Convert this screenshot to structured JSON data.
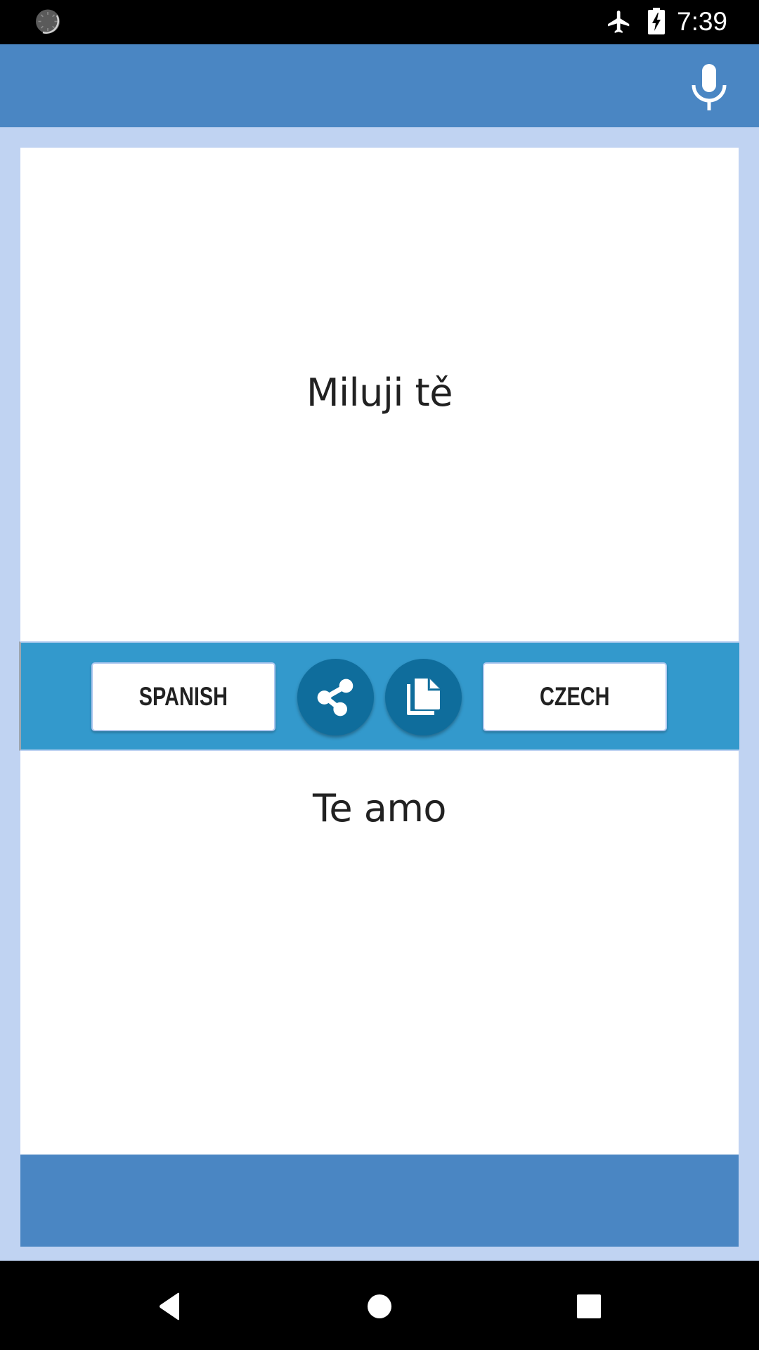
{
  "status_bar": {
    "time": "7:39",
    "icons": [
      "sync-icon",
      "airplane-mode-icon",
      "battery-charging-icon"
    ]
  },
  "app_bar": {
    "icons": [
      "microphone-icon"
    ]
  },
  "translation": {
    "source_text": "Miluji tě",
    "target_text": "Te amo"
  },
  "action_bar": {
    "source_language": "SPANISH",
    "target_language": "CZECH",
    "icons": [
      "share-icon",
      "copy-icon"
    ]
  },
  "nav_bar": {
    "icons": [
      "back-icon",
      "home-icon",
      "recents-icon"
    ]
  },
  "colors": {
    "app_bar": "#4A86C3",
    "background": "#C0D3F2",
    "action_bar": "#3399CC",
    "circle_button": "#0F6D9C",
    "text": "#212121"
  }
}
